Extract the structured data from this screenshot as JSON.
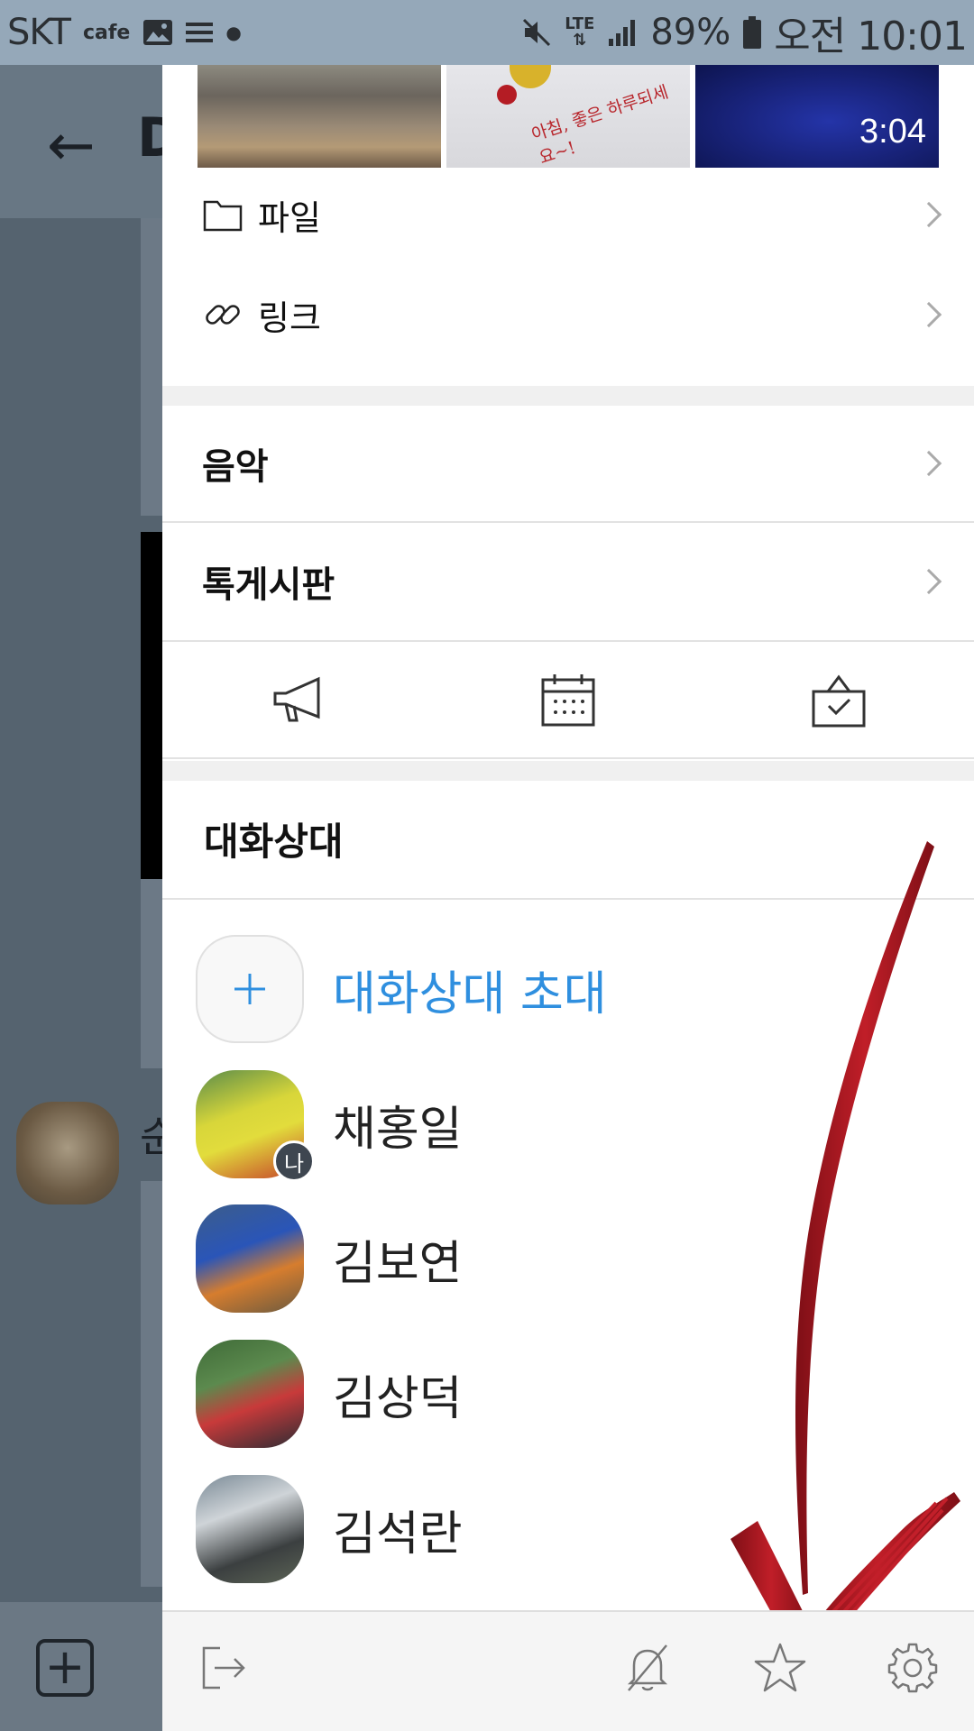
{
  "status_bar": {
    "carrier": "SKT",
    "app_label": "cafe",
    "network": "LTE",
    "battery": "89%",
    "time": "오전 10:01"
  },
  "background": {
    "title": "D",
    "sender_name": "순"
  },
  "drawer": {
    "media": {
      "video_duration": "3:04",
      "image2_text": "아침, 좋은 하루되세요~!"
    },
    "menu": {
      "file_label": "파일",
      "link_label": "링크",
      "music_label": "음악",
      "board_label": "톡게시판"
    },
    "tools": [
      "announcement-icon",
      "calendar-icon",
      "vote-icon"
    ],
    "members_title": "대화상대",
    "invite_label": "대화상대 초대",
    "me_badge": "나",
    "members": [
      {
        "name": "채홍일"
      },
      {
        "name": "김보연"
      },
      {
        "name": "김상덕"
      },
      {
        "name": "김석란"
      }
    ],
    "bottom_icons": [
      "exit-icon",
      "notification-off-icon",
      "star-icon",
      "settings-icon"
    ]
  },
  "colors": {
    "accent": "#2f8fdf",
    "status_bar_bg": "#95a8b9",
    "annotation_arrow": "#a0141c"
  }
}
